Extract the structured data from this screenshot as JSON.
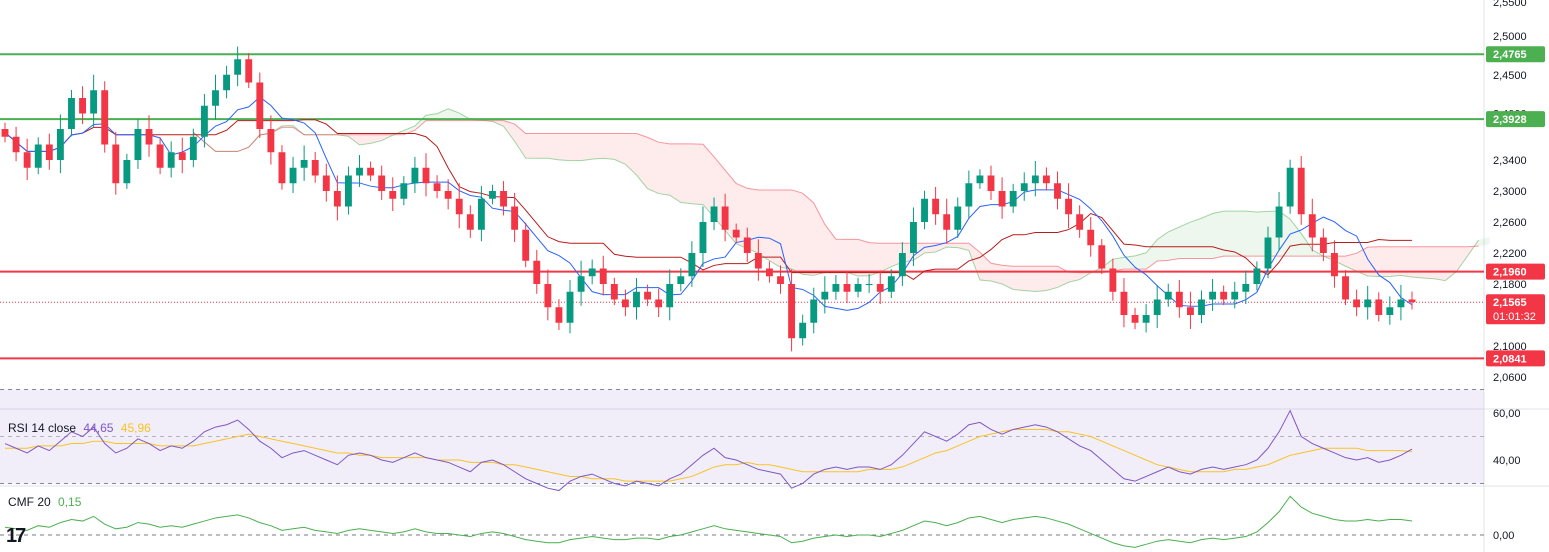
{
  "price_axis": {
    "ticks": [
      "2,5500",
      "2,5000",
      "2,4500",
      "2,4000",
      "2,3400",
      "2,3000",
      "2,2600",
      "2,2200",
      "2,1800",
      "2,1000",
      "2,0600"
    ],
    "tick_values": [
      2.55,
      2.5,
      2.45,
      2.4,
      2.34,
      2.3,
      2.26,
      2.22,
      2.18,
      2.1,
      2.06
    ]
  },
  "levels": [
    {
      "label": "2,4765",
      "value": 2.4765,
      "color": "#4caf50"
    },
    {
      "label": "2,3928",
      "value": 2.3928,
      "color": "#4caf50"
    },
    {
      "label": "2,1960",
      "value": 2.196,
      "color": "#f23645"
    },
    {
      "label": "2,0841",
      "value": 2.0841,
      "color": "#f23645"
    }
  ],
  "current_price": {
    "label": "2,1565",
    "value": 2.1565,
    "countdown": "01:01:32",
    "color": "#f23645"
  },
  "rsi": {
    "title": "RSI 14 close",
    "value": "44,65",
    "ma_value": "45,96",
    "ticks": [
      "60,00",
      "40,00"
    ],
    "line_color": "#7e57c2",
    "ma_color": "#f7c326"
  },
  "cmf": {
    "title": "CMF 20",
    "value": "0,15",
    "ticks": [
      "0,00"
    ],
    "line_color": "#4caf50"
  },
  "colors": {
    "up": "#089981",
    "down": "#f23645",
    "tenkan": "#2962ff",
    "kijun": "#b71c1c"
  },
  "logo_text": "17",
  "chart_data": {
    "type": "candlestick",
    "ylim": [
      2.035,
      2.555
    ],
    "series": [
      {
        "name": "price",
        "values": [
          2.37,
          2.35,
          2.33,
          2.36,
          2.34,
          2.38,
          2.42,
          2.4,
          2.43,
          2.36,
          2.31,
          2.34,
          2.38,
          2.36,
          2.33,
          2.35,
          2.34,
          2.37,
          2.41,
          2.43,
          2.45,
          2.47,
          2.44,
          2.38,
          2.35,
          2.31,
          2.33,
          2.34,
          2.32,
          2.3,
          2.28,
          2.32,
          2.33,
          2.32,
          2.3,
          2.29,
          2.31,
          2.33,
          2.31,
          2.3,
          2.29,
          2.27,
          2.25,
          2.29,
          2.3,
          2.28,
          2.25,
          2.21,
          2.18,
          2.15,
          2.13,
          2.17,
          2.19,
          2.2,
          2.18,
          2.16,
          2.15,
          2.17,
          2.16,
          2.15,
          2.18,
          2.19,
          2.22,
          2.26,
          2.28,
          2.25,
          2.24,
          2.22,
          2.2,
          2.19,
          2.18,
          2.11,
          2.13,
          2.16,
          2.17,
          2.18,
          2.17,
          2.18,
          2.18,
          2.17,
          2.19,
          2.22,
          2.26,
          2.29,
          2.27,
          2.25,
          2.28,
          2.31,
          2.32,
          2.3,
          2.28,
          2.3,
          2.31,
          2.32,
          2.31,
          2.29,
          2.27,
          2.25,
          2.23,
          2.2,
          2.17,
          2.14,
          2.13,
          2.14,
          2.16,
          2.17,
          2.15,
          2.14,
          2.16,
          2.17,
          2.16,
          2.17,
          2.18,
          2.2,
          2.24,
          2.28,
          2.33,
          2.27,
          2.24,
          2.22,
          2.19,
          2.16,
          2.15,
          2.16,
          2.14,
          2.15,
          2.16,
          2.1565
        ]
      },
      {
        "name": "RSI",
        "values": [
          47,
          45,
          43,
          46,
          44,
          48,
          52,
          50,
          54,
          47,
          43,
          45,
          49,
          47,
          44,
          46,
          45,
          48,
          52,
          54,
          55,
          57,
          53,
          48,
          45,
          41,
          43,
          44,
          42,
          40,
          38,
          42,
          43,
          42,
          40,
          39,
          41,
          43,
          41,
          40,
          39,
          37,
          35,
          39,
          40,
          38,
          35,
          32,
          30,
          28,
          27,
          31,
          33,
          34,
          32,
          30,
          29,
          31,
          30,
          29,
          32,
          34,
          38,
          42,
          45,
          41,
          40,
          38,
          36,
          35,
          34,
          28,
          30,
          34,
          36,
          37,
          36,
          37,
          37,
          36,
          38,
          42,
          47,
          52,
          50,
          48,
          51,
          55,
          56,
          53,
          51,
          53,
          54,
          55,
          54,
          52,
          49,
          46,
          44,
          40,
          36,
          32,
          31,
          33,
          35,
          37,
          35,
          34,
          36,
          37,
          36,
          37,
          38,
          40,
          45,
          52,
          61,
          50,
          47,
          45,
          43,
          41,
          40,
          41,
          39,
          40,
          42,
          44.65
        ]
      },
      {
        "name": "RSI MA",
        "values": [
          45,
          45,
          45,
          46,
          46,
          46,
          47,
          47,
          48,
          48,
          47,
          47,
          47,
          47,
          46,
          46,
          46,
          46,
          47,
          48,
          49,
          50,
          51,
          50,
          49,
          48,
          47,
          46,
          45,
          44,
          43,
          43,
          42,
          42,
          41,
          41,
          41,
          41,
          41,
          40,
          40,
          40,
          39,
          39,
          39,
          38,
          38,
          37,
          36,
          35,
          34,
          33,
          33,
          32,
          32,
          32,
          31,
          31,
          31,
          31,
          31,
          32,
          33,
          35,
          37,
          38,
          38,
          39,
          38,
          38,
          37,
          36,
          35,
          35,
          35,
          35,
          35,
          35,
          36,
          36,
          36,
          37,
          39,
          41,
          43,
          44,
          46,
          48,
          50,
          51,
          52,
          53,
          53,
          53,
          53,
          52,
          52,
          51,
          50,
          48,
          46,
          44,
          42,
          40,
          38,
          37,
          36,
          35,
          35,
          35,
          35,
          36,
          36,
          37,
          38,
          40,
          42,
          43,
          44,
          45,
          45,
          45,
          45,
          44,
          44,
          44,
          44,
          43.5
        ]
      },
      {
        "name": "CMF",
        "values": [
          0.05,
          0.04,
          0.03,
          0.06,
          0.05,
          0.08,
          0.1,
          0.09,
          0.12,
          0.07,
          0.04,
          0.05,
          0.08,
          0.07,
          0.05,
          0.06,
          0.05,
          0.07,
          0.09,
          0.11,
          0.12,
          0.13,
          0.11,
          0.08,
          0.06,
          0.03,
          0.04,
          0.05,
          0.03,
          0.02,
          0.01,
          0.03,
          0.04,
          0.03,
          0.02,
          0.01,
          0.02,
          0.04,
          0.02,
          0.01,
          0.01,
          0.0,
          -0.01,
          0.01,
          0.02,
          0.01,
          -0.01,
          -0.03,
          -0.04,
          -0.05,
          -0.05,
          -0.03,
          -0.02,
          -0.01,
          -0.02,
          -0.03,
          -0.03,
          -0.02,
          -0.02,
          -0.03,
          -0.01,
          0.0,
          0.02,
          0.04,
          0.06,
          0.04,
          0.03,
          0.02,
          0.01,
          0.0,
          -0.01,
          -0.05,
          -0.04,
          -0.02,
          -0.01,
          0.0,
          -0.01,
          0.0,
          0.0,
          -0.01,
          0.01,
          0.03,
          0.06,
          0.09,
          0.08,
          0.06,
          0.08,
          0.11,
          0.12,
          0.1,
          0.08,
          0.1,
          0.11,
          0.12,
          0.11,
          0.09,
          0.07,
          0.04,
          0.01,
          -0.02,
          -0.05,
          -0.07,
          -0.08,
          -0.06,
          -0.04,
          -0.03,
          -0.04,
          -0.05,
          -0.03,
          -0.02,
          -0.03,
          -0.02,
          -0.01,
          0.02,
          0.08,
          0.15,
          0.25,
          0.18,
          0.14,
          0.12,
          0.1,
          0.09,
          0.09,
          0.1,
          0.09,
          0.1,
          0.1,
          0.09
        ]
      }
    ]
  }
}
